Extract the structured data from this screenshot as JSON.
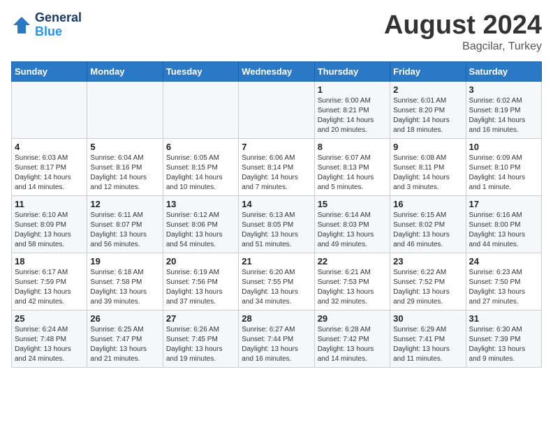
{
  "header": {
    "logo_line1": "General",
    "logo_line2": "Blue",
    "month_title": "August 2024",
    "location": "Bagcilar, Turkey"
  },
  "days_of_week": [
    "Sunday",
    "Monday",
    "Tuesday",
    "Wednesday",
    "Thursday",
    "Friday",
    "Saturday"
  ],
  "weeks": [
    [
      {
        "day": "",
        "info": ""
      },
      {
        "day": "",
        "info": ""
      },
      {
        "day": "",
        "info": ""
      },
      {
        "day": "",
        "info": ""
      },
      {
        "day": "1",
        "info": "Sunrise: 6:00 AM\nSunset: 8:21 PM\nDaylight: 14 hours\nand 20 minutes."
      },
      {
        "day": "2",
        "info": "Sunrise: 6:01 AM\nSunset: 8:20 PM\nDaylight: 14 hours\nand 18 minutes."
      },
      {
        "day": "3",
        "info": "Sunrise: 6:02 AM\nSunset: 8:19 PM\nDaylight: 14 hours\nand 16 minutes."
      }
    ],
    [
      {
        "day": "4",
        "info": "Sunrise: 6:03 AM\nSunset: 8:17 PM\nDaylight: 14 hours\nand 14 minutes."
      },
      {
        "day": "5",
        "info": "Sunrise: 6:04 AM\nSunset: 8:16 PM\nDaylight: 14 hours\nand 12 minutes."
      },
      {
        "day": "6",
        "info": "Sunrise: 6:05 AM\nSunset: 8:15 PM\nDaylight: 14 hours\nand 10 minutes."
      },
      {
        "day": "7",
        "info": "Sunrise: 6:06 AM\nSunset: 8:14 PM\nDaylight: 14 hours\nand 7 minutes."
      },
      {
        "day": "8",
        "info": "Sunrise: 6:07 AM\nSunset: 8:13 PM\nDaylight: 14 hours\nand 5 minutes."
      },
      {
        "day": "9",
        "info": "Sunrise: 6:08 AM\nSunset: 8:11 PM\nDaylight: 14 hours\nand 3 minutes."
      },
      {
        "day": "10",
        "info": "Sunrise: 6:09 AM\nSunset: 8:10 PM\nDaylight: 14 hours\nand 1 minute."
      }
    ],
    [
      {
        "day": "11",
        "info": "Sunrise: 6:10 AM\nSunset: 8:09 PM\nDaylight: 13 hours\nand 58 minutes."
      },
      {
        "day": "12",
        "info": "Sunrise: 6:11 AM\nSunset: 8:07 PM\nDaylight: 13 hours\nand 56 minutes."
      },
      {
        "day": "13",
        "info": "Sunrise: 6:12 AM\nSunset: 8:06 PM\nDaylight: 13 hours\nand 54 minutes."
      },
      {
        "day": "14",
        "info": "Sunrise: 6:13 AM\nSunset: 8:05 PM\nDaylight: 13 hours\nand 51 minutes."
      },
      {
        "day": "15",
        "info": "Sunrise: 6:14 AM\nSunset: 8:03 PM\nDaylight: 13 hours\nand 49 minutes."
      },
      {
        "day": "16",
        "info": "Sunrise: 6:15 AM\nSunset: 8:02 PM\nDaylight: 13 hours\nand 46 minutes."
      },
      {
        "day": "17",
        "info": "Sunrise: 6:16 AM\nSunset: 8:00 PM\nDaylight: 13 hours\nand 44 minutes."
      }
    ],
    [
      {
        "day": "18",
        "info": "Sunrise: 6:17 AM\nSunset: 7:59 PM\nDaylight: 13 hours\nand 42 minutes."
      },
      {
        "day": "19",
        "info": "Sunrise: 6:18 AM\nSunset: 7:58 PM\nDaylight: 13 hours\nand 39 minutes."
      },
      {
        "day": "20",
        "info": "Sunrise: 6:19 AM\nSunset: 7:56 PM\nDaylight: 13 hours\nand 37 minutes."
      },
      {
        "day": "21",
        "info": "Sunrise: 6:20 AM\nSunset: 7:55 PM\nDaylight: 13 hours\nand 34 minutes."
      },
      {
        "day": "22",
        "info": "Sunrise: 6:21 AM\nSunset: 7:53 PM\nDaylight: 13 hours\nand 32 minutes."
      },
      {
        "day": "23",
        "info": "Sunrise: 6:22 AM\nSunset: 7:52 PM\nDaylight: 13 hours\nand 29 minutes."
      },
      {
        "day": "24",
        "info": "Sunrise: 6:23 AM\nSunset: 7:50 PM\nDaylight: 13 hours\nand 27 minutes."
      }
    ],
    [
      {
        "day": "25",
        "info": "Sunrise: 6:24 AM\nSunset: 7:48 PM\nDaylight: 13 hours\nand 24 minutes."
      },
      {
        "day": "26",
        "info": "Sunrise: 6:25 AM\nSunset: 7:47 PM\nDaylight: 13 hours\nand 21 minutes."
      },
      {
        "day": "27",
        "info": "Sunrise: 6:26 AM\nSunset: 7:45 PM\nDaylight: 13 hours\nand 19 minutes."
      },
      {
        "day": "28",
        "info": "Sunrise: 6:27 AM\nSunset: 7:44 PM\nDaylight: 13 hours\nand 16 minutes."
      },
      {
        "day": "29",
        "info": "Sunrise: 6:28 AM\nSunset: 7:42 PM\nDaylight: 13 hours\nand 14 minutes."
      },
      {
        "day": "30",
        "info": "Sunrise: 6:29 AM\nSunset: 7:41 PM\nDaylight: 13 hours\nand 11 minutes."
      },
      {
        "day": "31",
        "info": "Sunrise: 6:30 AM\nSunset: 7:39 PM\nDaylight: 13 hours\nand 9 minutes."
      }
    ]
  ]
}
